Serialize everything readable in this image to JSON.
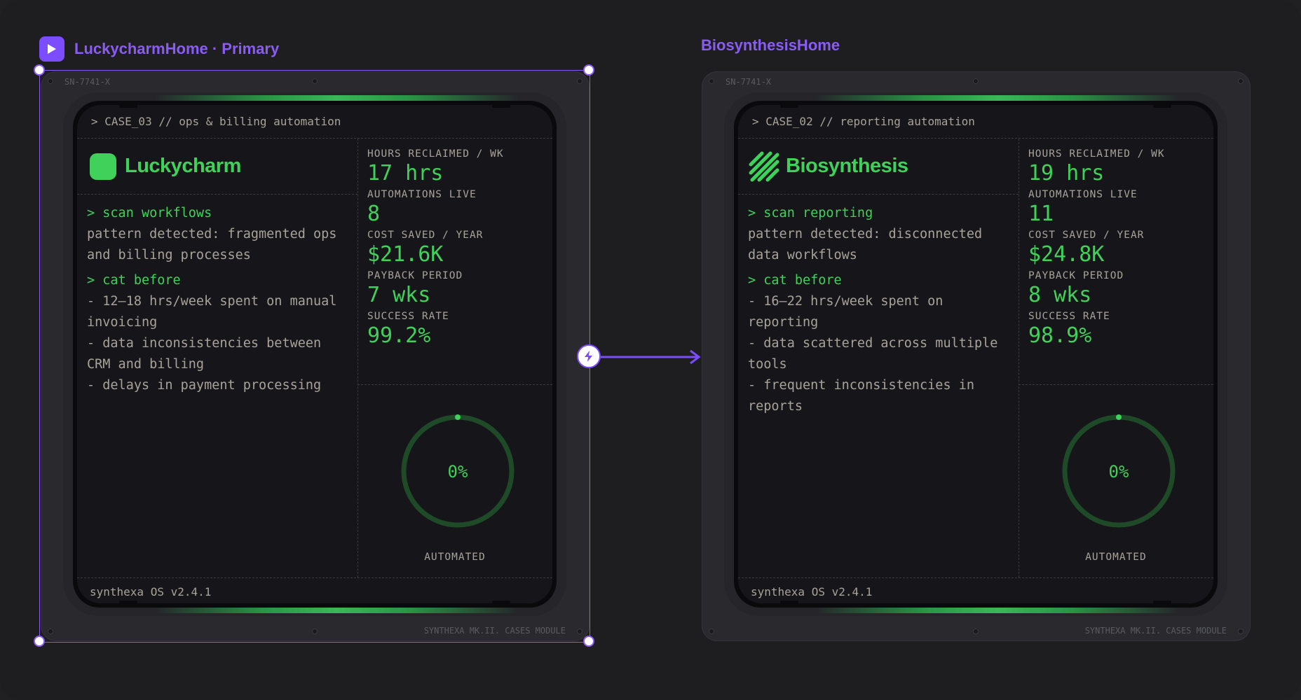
{
  "frames": [
    {
      "title": "LuckycharmHome · Primary",
      "serial": "SN-7741-X",
      "module": "SYNTHEXA MK.II. CASES MODULE",
      "case_header": "> CASE_03 // ops & billing automation",
      "brand": "Luckycharm",
      "brand_icon": "clover-icon",
      "terminal": {
        "cmd1": "> scan workflows",
        "pattern": "pattern detected: fragmented ops and billing processes",
        "cmd2": "> cat before",
        "items": [
          "- 12–18 hrs/week spent on manual invoicing",
          "- data inconsistencies between CRM and billing",
          "- delays in payment processing"
        ]
      },
      "stats": [
        {
          "label": "HOURS RECLAIMED / WK",
          "value": "17 hrs"
        },
        {
          "label": "AUTOMATIONS LIVE",
          "value": "8"
        },
        {
          "label": "COST SAVED / YEAR",
          "value": "$21.6K"
        },
        {
          "label": "PAYBACK PERIOD",
          "value": "7 wks"
        },
        {
          "label": "SUCCESS RATE",
          "value": "99.2%"
        }
      ],
      "gauge": {
        "value": "0%",
        "label": "AUTOMATED",
        "fraction": 0
      },
      "footer": "synthexa OS v2.4.1"
    },
    {
      "title": "BiosynthesisHome",
      "serial": "SN-7741-X",
      "module": "SYNTHEXA MK.II. CASES MODULE",
      "case_header": "> CASE_02 // reporting automation",
      "brand": "Biosynthesis",
      "brand_icon": "diagonal-stripes-icon",
      "terminal": {
        "cmd1": "> scan reporting",
        "pattern": "pattern detected: disconnected data workflows",
        "cmd2": "> cat before",
        "items": [
          "- 16–22 hrs/week spent on reporting",
          "- data scattered across multiple tools",
          "- frequent inconsistencies in reports"
        ]
      },
      "stats": [
        {
          "label": "HOURS RECLAIMED / WK",
          "value": "19 hrs"
        },
        {
          "label": "AUTOMATIONS LIVE",
          "value": "11"
        },
        {
          "label": "COST SAVED / YEAR",
          "value": "$24.8K"
        },
        {
          "label": "PAYBACK PERIOD",
          "value": "8 wks"
        },
        {
          "label": "SUCCESS RATE",
          "value": "98.9%"
        }
      ],
      "gauge": {
        "value": "0%",
        "label": "AUTOMATED",
        "fraction": 0
      },
      "footer": "synthexa OS v2.4.1"
    }
  ],
  "colors": {
    "accent": "#8a5cf5",
    "green": "#3fd15a",
    "text": "#a8a39a"
  }
}
